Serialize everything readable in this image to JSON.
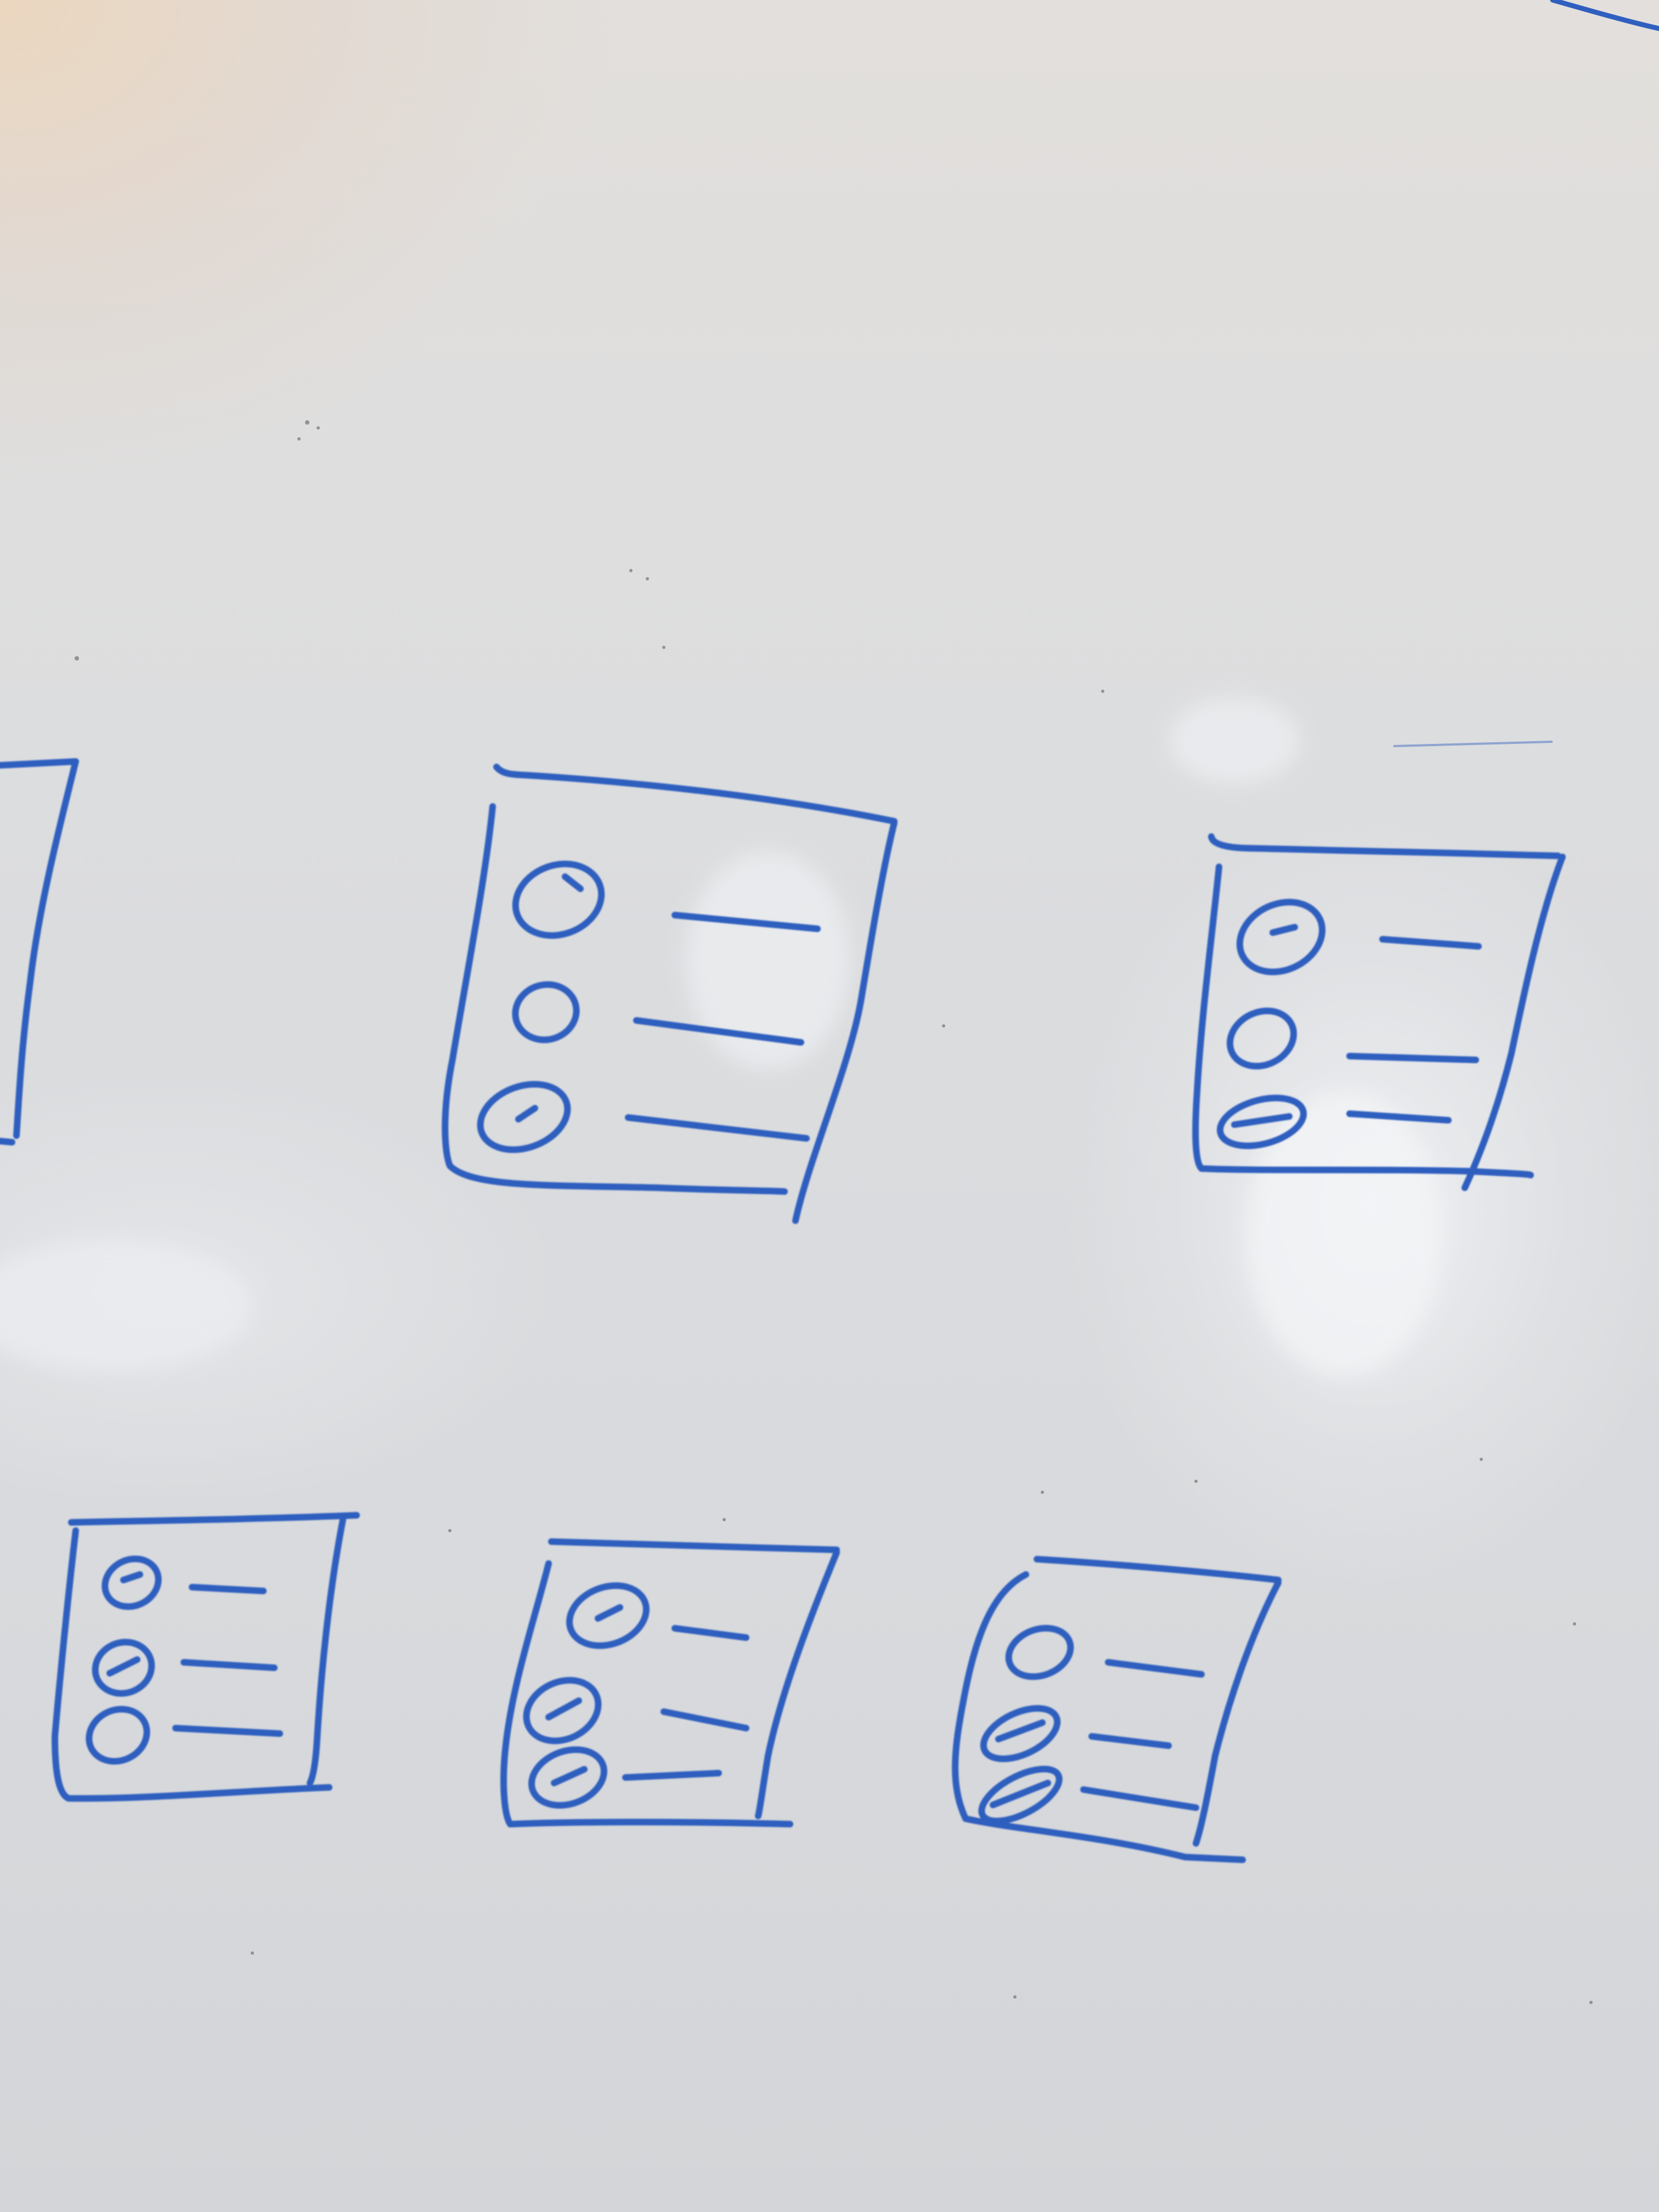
{
  "scene": {
    "subject": "whiteboard",
    "ink_color": "#2f5fbf",
    "board_color": "#dcdde0"
  },
  "sketches": [
    {
      "id": "partial-left",
      "kind": "partial-frame-edge"
    },
    {
      "id": "card-top-center",
      "kind": "list-card",
      "rows": 3
    },
    {
      "id": "card-top-right",
      "kind": "list-card",
      "rows": 3
    },
    {
      "id": "card-bottom-left",
      "kind": "list-card",
      "rows": 3
    },
    {
      "id": "card-bottom-center",
      "kind": "list-card",
      "rows": 3
    },
    {
      "id": "card-bottom-right",
      "kind": "list-card",
      "rows": 3
    }
  ]
}
